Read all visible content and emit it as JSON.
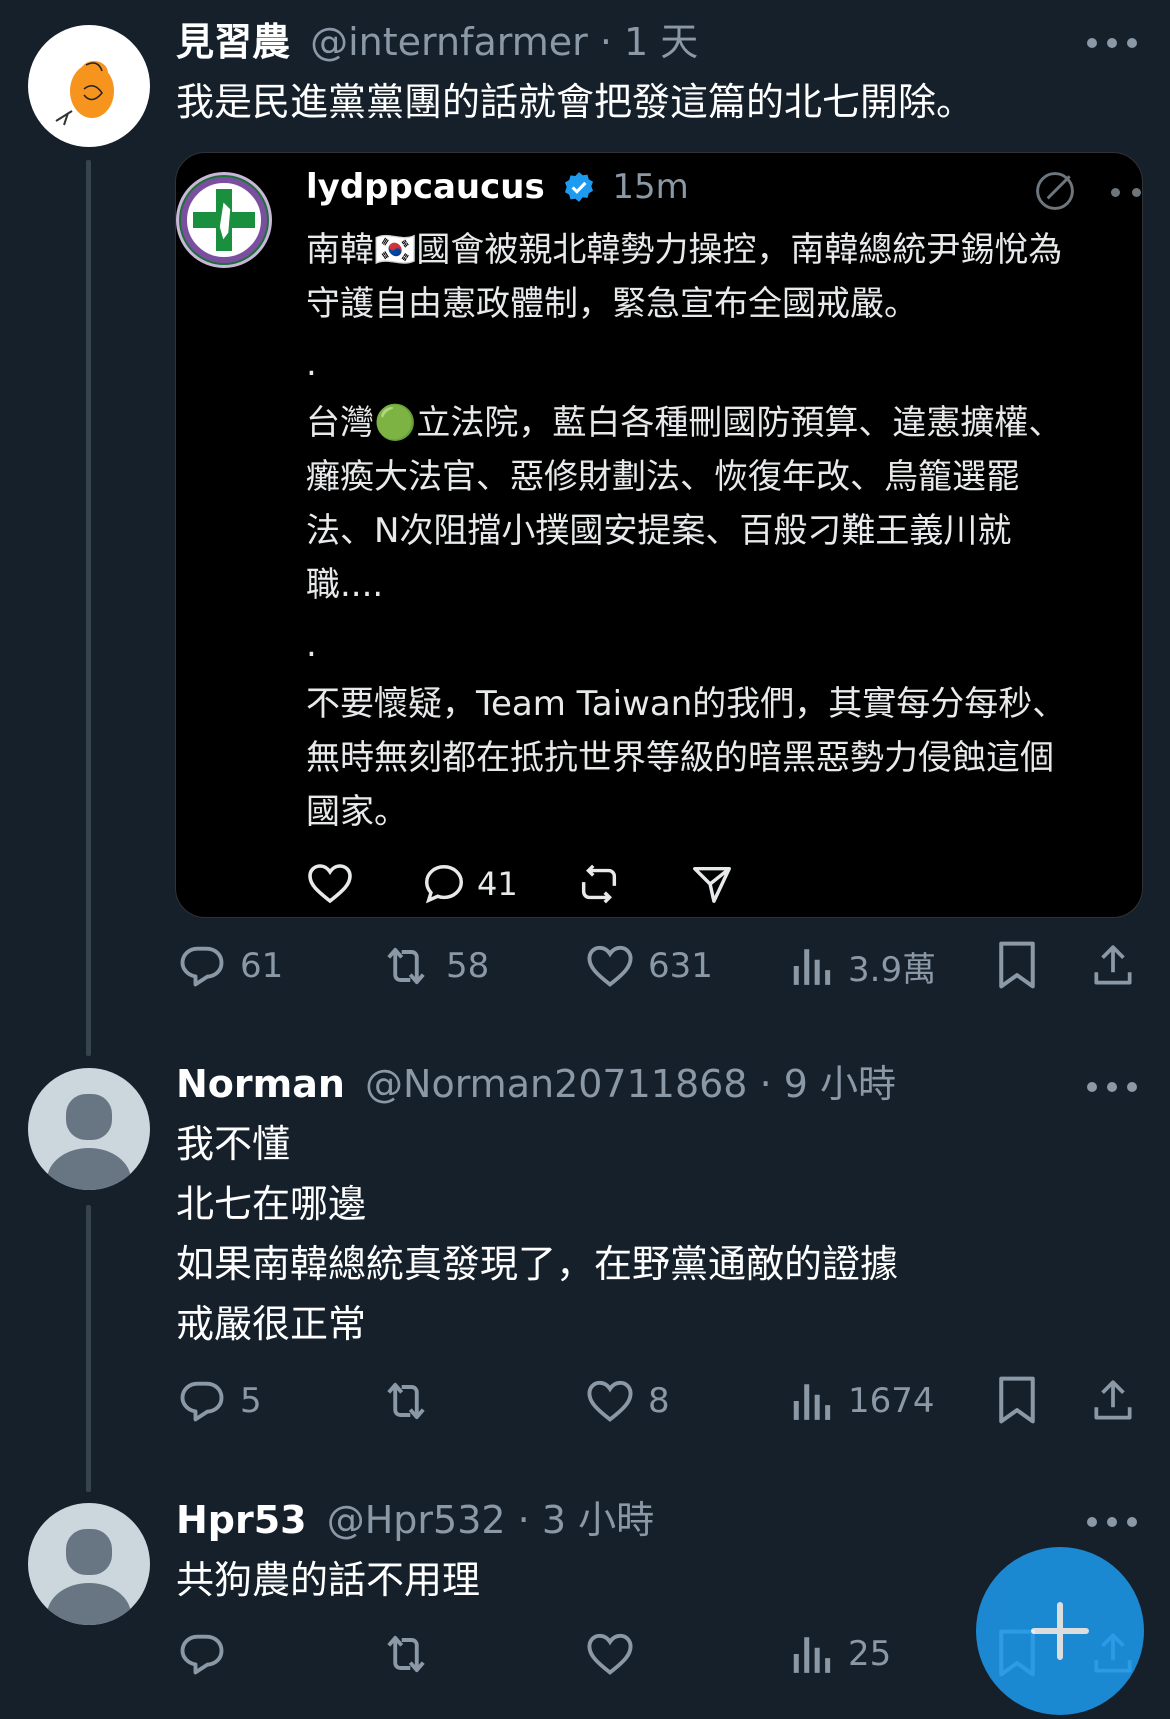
{
  "tweets": [
    {
      "name": "見習農",
      "handle": "@internfarmer",
      "dot": "·",
      "time": "1 天",
      "lines": [
        "我是民進黨黨團的話就會把發這篇的北七開除。"
      ],
      "actions": {
        "reply": "61",
        "retweet": "58",
        "like": "631",
        "views": "3.9萬"
      }
    },
    {
      "name": "Norman",
      "handle": "@Norman20711868",
      "dot": "·",
      "time": "9 小時",
      "lines": [
        "我不懂",
        "北七在哪邊",
        "如果南韓總統真發現了，在野黨通敵的證據",
        "戒嚴很正常"
      ],
      "actions": {
        "reply": "5",
        "retweet": "",
        "like": "8",
        "views": "1674"
      }
    },
    {
      "name": "Hpr53",
      "handle": "@Hpr532",
      "dot": "·",
      "time": "3 小時",
      "lines": [
        "共狗農的話不用理"
      ],
      "actions": {
        "reply": "",
        "retweet": "",
        "like": "",
        "views": "25"
      }
    }
  ],
  "quoted": {
    "username": "lydppcaucus",
    "time": "15m",
    "lines": [
      "南韓🇰🇷國會被親北韓勢力操控，南韓總統尹錫悅為",
      "守護自由憲政體制，緊急宣布全國戒嚴。",
      ".",
      "台灣🟢立法院，藍白各種刪國防預算、違憲擴權、",
      "癱瘓大法官、惡修財劃法、恢復年改、鳥籠選罷",
      "法、N次阻擋小撲國安提案、百般刁難王義川就",
      "職....",
      ".",
      "不要懷疑，Team Taiwan的我們，其實每分每秒、",
      "無時無刻都在抵抗世界等級的暗黑惡勢力侵蝕這個",
      "國家。"
    ],
    "actions": {
      "replies": "41"
    }
  },
  "colors": {
    "background": "#15202b",
    "muted": "#8b98a5",
    "accent": "#1d9bf0",
    "verified": "#1d9bf0"
  },
  "icons": [
    "more-icon",
    "reply-icon",
    "retweet-icon",
    "like-icon",
    "views-icon",
    "bookmark-icon",
    "share-icon",
    "verified-badge-icon",
    "edit-icon",
    "send-icon",
    "compose-plus-icon"
  ]
}
